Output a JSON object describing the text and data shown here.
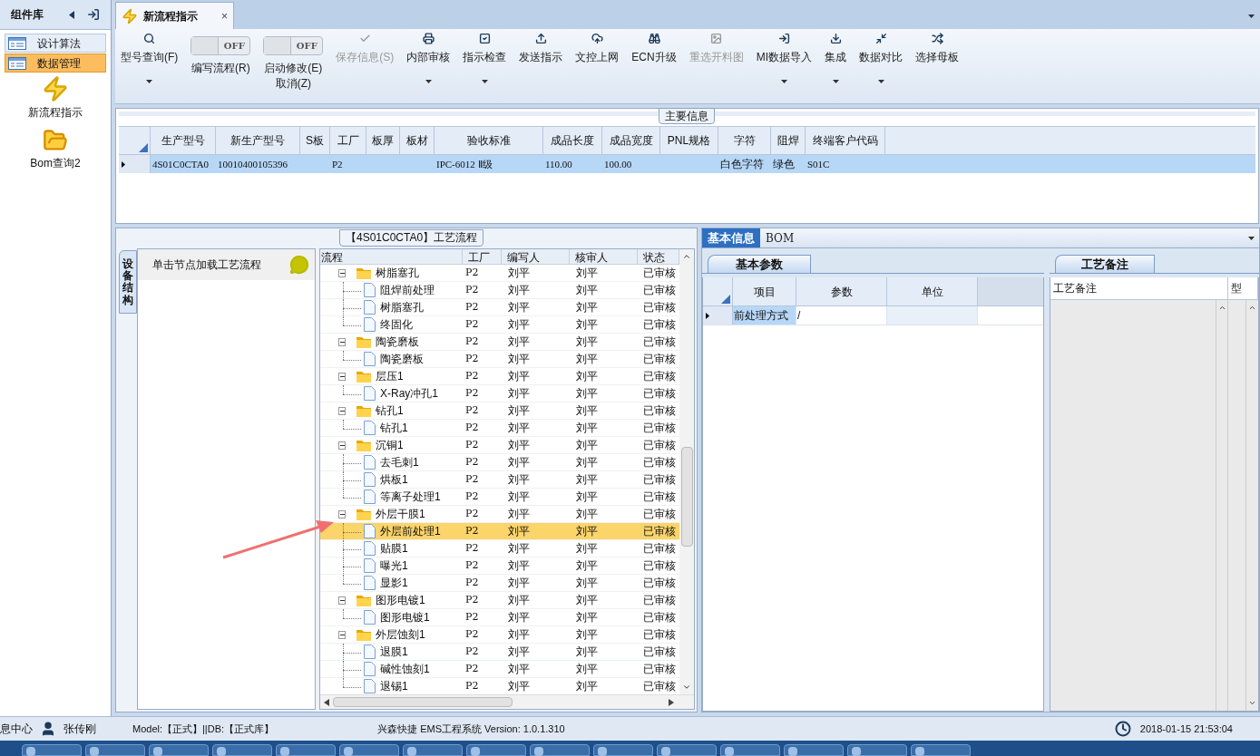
{
  "sidebar": {
    "title": "组件库",
    "groups": [
      {
        "label": "设计算法",
        "selected": false
      },
      {
        "label": "数据管理",
        "selected": true
      }
    ],
    "items": [
      {
        "label": "新流程指示",
        "kind": "bolt"
      },
      {
        "label": "Bom查询2",
        "kind": "folder"
      }
    ]
  },
  "tabs": [
    {
      "label": "新流程指示",
      "close": "×",
      "selected": true
    }
  ],
  "toolbar": [
    {
      "kind": "button",
      "label": "型号查询(F)",
      "dropdown": true,
      "disabled": false
    },
    {
      "kind": "toggle",
      "toggle_text": "OFF",
      "on": false,
      "label": "编写流程(R)"
    },
    {
      "kind": "toggle",
      "toggle_text": "OFF",
      "on": false,
      "label": "启动修改(E)\n取消(Z)"
    },
    {
      "kind": "button",
      "label": "保存信息(S)",
      "dropdown": false,
      "disabled": true
    },
    {
      "kind": "button",
      "label": "内部审核",
      "dropdown": true,
      "disabled": false
    },
    {
      "kind": "button",
      "label": "指示检查",
      "dropdown": true,
      "disabled": false
    },
    {
      "kind": "button",
      "label": "发送指示",
      "dropdown": false,
      "disabled": false
    },
    {
      "kind": "button",
      "label": "文控上网",
      "dropdown": false,
      "disabled": false
    },
    {
      "kind": "button",
      "label": "ECN升级",
      "dropdown": false,
      "disabled": false
    },
    {
      "kind": "button",
      "label": "重选开料图",
      "dropdown": false,
      "disabled": true
    },
    {
      "kind": "button",
      "label": "MI数据导入",
      "dropdown": true,
      "disabled": false
    },
    {
      "kind": "button",
      "label": "集成",
      "dropdown": true,
      "disabled": false
    },
    {
      "kind": "button",
      "label": "数据对比",
      "dropdown": true,
      "disabled": false
    },
    {
      "kind": "button",
      "label": "选择母板",
      "dropdown": false,
      "disabled": false
    }
  ],
  "main_info": {
    "title": "主要信息",
    "columns": [
      "生产型号",
      "新生产型号",
      "S板",
      "工厂",
      "板厚",
      "板材",
      "验收标准",
      "成品长度",
      "成品宽度",
      "PNL规格",
      "字符",
      "阻焊",
      "终端客户代码"
    ],
    "rows": [
      {
        "selected": true,
        "cells": [
          "4S01C0CTA0",
          "10010400105396",
          "",
          "P2",
          "",
          "",
          "IPC-6012 Ⅱ级",
          "110.00",
          "100.00",
          "",
          "白色字符",
          "绿色",
          "S01C"
        ]
      }
    ]
  },
  "process": {
    "title": "【4S01C0CTA0】工艺流程",
    "side_tab": "设备结构",
    "hint": "单击节点加载工艺流程",
    "columns": [
      "流程",
      "工厂",
      "编写人",
      "核审人",
      "状态"
    ],
    "tree": [
      {
        "name": "树脂塞孔",
        "factory": "P2",
        "writer": "刘平",
        "reviewer": "刘平",
        "status": "已审核",
        "expanded": true,
        "selected": false,
        "children": [
          {
            "name": "阻焊前处理",
            "factory": "P2",
            "writer": "刘平",
            "reviewer": "刘平",
            "status": "已审核",
            "selected": false
          },
          {
            "name": "树脂塞孔",
            "factory": "P2",
            "writer": "刘平",
            "reviewer": "刘平",
            "status": "已审核",
            "selected": false
          },
          {
            "name": "终固化",
            "factory": "P2",
            "writer": "刘平",
            "reviewer": "刘平",
            "status": "已审核",
            "selected": false
          }
        ]
      },
      {
        "name": "陶瓷磨板",
        "factory": "P2",
        "writer": "刘平",
        "reviewer": "刘平",
        "status": "已审核",
        "expanded": true,
        "selected": false,
        "children": [
          {
            "name": "陶瓷磨板",
            "factory": "P2",
            "writer": "刘平",
            "reviewer": "刘平",
            "status": "已审核",
            "selected": false
          }
        ]
      },
      {
        "name": "层压1",
        "factory": "P2",
        "writer": "刘平",
        "reviewer": "刘平",
        "status": "已审核",
        "expanded": true,
        "selected": false,
        "children": [
          {
            "name": "X-Ray冲孔1",
            "factory": "P2",
            "writer": "刘平",
            "reviewer": "刘平",
            "status": "已审核",
            "selected": false
          }
        ]
      },
      {
        "name": "钻孔1",
        "factory": "P2",
        "writer": "刘平",
        "reviewer": "刘平",
        "status": "已审核",
        "expanded": true,
        "selected": false,
        "children": [
          {
            "name": "钻孔1",
            "factory": "P2",
            "writer": "刘平",
            "reviewer": "刘平",
            "status": "已审核",
            "selected": false
          }
        ]
      },
      {
        "name": "沉铜1",
        "factory": "P2",
        "writer": "刘平",
        "reviewer": "刘平",
        "status": "已审核",
        "expanded": true,
        "selected": false,
        "children": [
          {
            "name": "去毛刺1",
            "factory": "P2",
            "writer": "刘平",
            "reviewer": "刘平",
            "status": "已审核",
            "selected": false
          },
          {
            "name": "烘板1",
            "factory": "P2",
            "writer": "刘平",
            "reviewer": "刘平",
            "status": "已审核",
            "selected": false
          },
          {
            "name": "等离子处理1",
            "factory": "P2",
            "writer": "刘平",
            "reviewer": "刘平",
            "status": "已审核",
            "selected": false
          }
        ]
      },
      {
        "name": "外层干膜1",
        "factory": "P2",
        "writer": "刘平",
        "reviewer": "刘平",
        "status": "已审核",
        "expanded": true,
        "selected": false,
        "children": [
          {
            "name": "外层前处理1",
            "factory": "P2",
            "writer": "刘平",
            "reviewer": "刘平",
            "status": "已审核",
            "selected": true
          },
          {
            "name": "贴膜1",
            "factory": "P2",
            "writer": "刘平",
            "reviewer": "刘平",
            "status": "已审核",
            "selected": false
          },
          {
            "name": "曝光1",
            "factory": "P2",
            "writer": "刘平",
            "reviewer": "刘平",
            "status": "已审核",
            "selected": false
          },
          {
            "name": "显影1",
            "factory": "P2",
            "writer": "刘平",
            "reviewer": "刘平",
            "status": "已审核",
            "selected": false
          }
        ]
      },
      {
        "name": "图形电镀1",
        "factory": "P2",
        "writer": "刘平",
        "reviewer": "刘平",
        "status": "已审核",
        "expanded": true,
        "selected": false,
        "children": [
          {
            "name": "图形电镀1",
            "factory": "P2",
            "writer": "刘平",
            "reviewer": "刘平",
            "status": "已审核",
            "selected": false
          }
        ]
      },
      {
        "name": "外层蚀刻1",
        "factory": "P2",
        "writer": "刘平",
        "reviewer": "刘平",
        "status": "已审核",
        "expanded": true,
        "selected": false,
        "children": [
          {
            "name": "退膜1",
            "factory": "P2",
            "writer": "刘平",
            "reviewer": "刘平",
            "status": "已审核",
            "selected": false
          },
          {
            "name": "碱性蚀刻1",
            "factory": "P2",
            "writer": "刘平",
            "reviewer": "刘平",
            "status": "已审核",
            "selected": false
          },
          {
            "name": "退锡1",
            "factory": "P2",
            "writer": "刘平",
            "reviewer": "刘平",
            "status": "已审核",
            "selected": false
          }
        ]
      }
    ]
  },
  "detail_tabs": [
    {
      "label": "基本信息",
      "selected": true
    },
    {
      "label": "BOM",
      "selected": false
    }
  ],
  "basic_params": {
    "tab": "基本参数",
    "columns": [
      "项目",
      "参数",
      "单位"
    ],
    "rows": [
      {
        "selected": true,
        "cells": [
          "前处理方式",
          "/",
          ""
        ]
      }
    ]
  },
  "notes": {
    "tab": "工艺备注",
    "columns": [
      "工艺备注",
      "型"
    ]
  },
  "status_bar": {
    "message_center": "息中心",
    "user": "张传刚",
    "model": "Model:【正式】||DB:【正式库】",
    "app": "兴森快捷 EMS工程系统 Version: 1.0.1.310",
    "time": "2018-01-15 21:53:04"
  }
}
